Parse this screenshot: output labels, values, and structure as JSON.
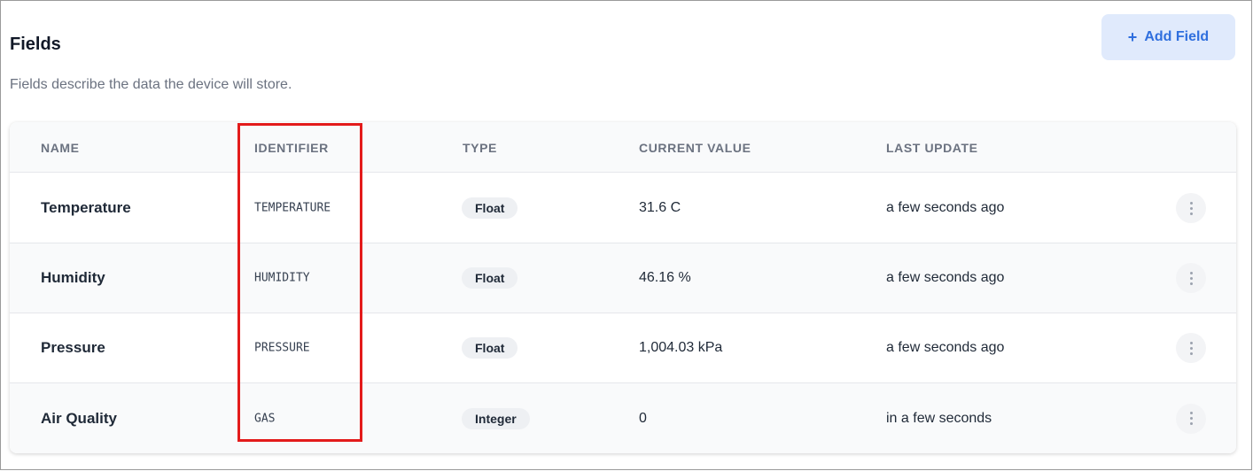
{
  "header": {
    "title": "Fields",
    "subtitle": "Fields describe the data the device will store.",
    "add_button": {
      "icon": "plus-icon",
      "icon_glyph": "+",
      "label": "Add Field"
    }
  },
  "table": {
    "columns": [
      "NAME",
      "IDENTIFIER",
      "TYPE",
      "CURRENT VALUE",
      "LAST UPDATE"
    ],
    "rows": [
      {
        "name": "Temperature",
        "identifier": "TEMPERATURE",
        "type": "Float",
        "value": "31.6 C",
        "updated": "a few seconds ago"
      },
      {
        "name": "Humidity",
        "identifier": "HUMIDITY",
        "type": "Float",
        "value": "46.16 %",
        "updated": "a few seconds ago"
      },
      {
        "name": "Pressure",
        "identifier": "PRESSURE",
        "type": "Float",
        "value": "1,004.03 kPa",
        "updated": "a few seconds ago"
      },
      {
        "name": "Air Quality",
        "identifier": "GAS",
        "type": "Integer",
        "value": "0",
        "updated": "in a few seconds"
      }
    ],
    "row_action_icon": "more-vertical-icon"
  },
  "annotation": {
    "highlight_color": "#e31b1b",
    "highlighted_column": "IDENTIFIER"
  },
  "colors": {
    "accent": "#2f6fde",
    "accent_bg": "#e0eafc",
    "header_bg": "#f9fafb",
    "badge_bg": "#eef0f3"
  }
}
